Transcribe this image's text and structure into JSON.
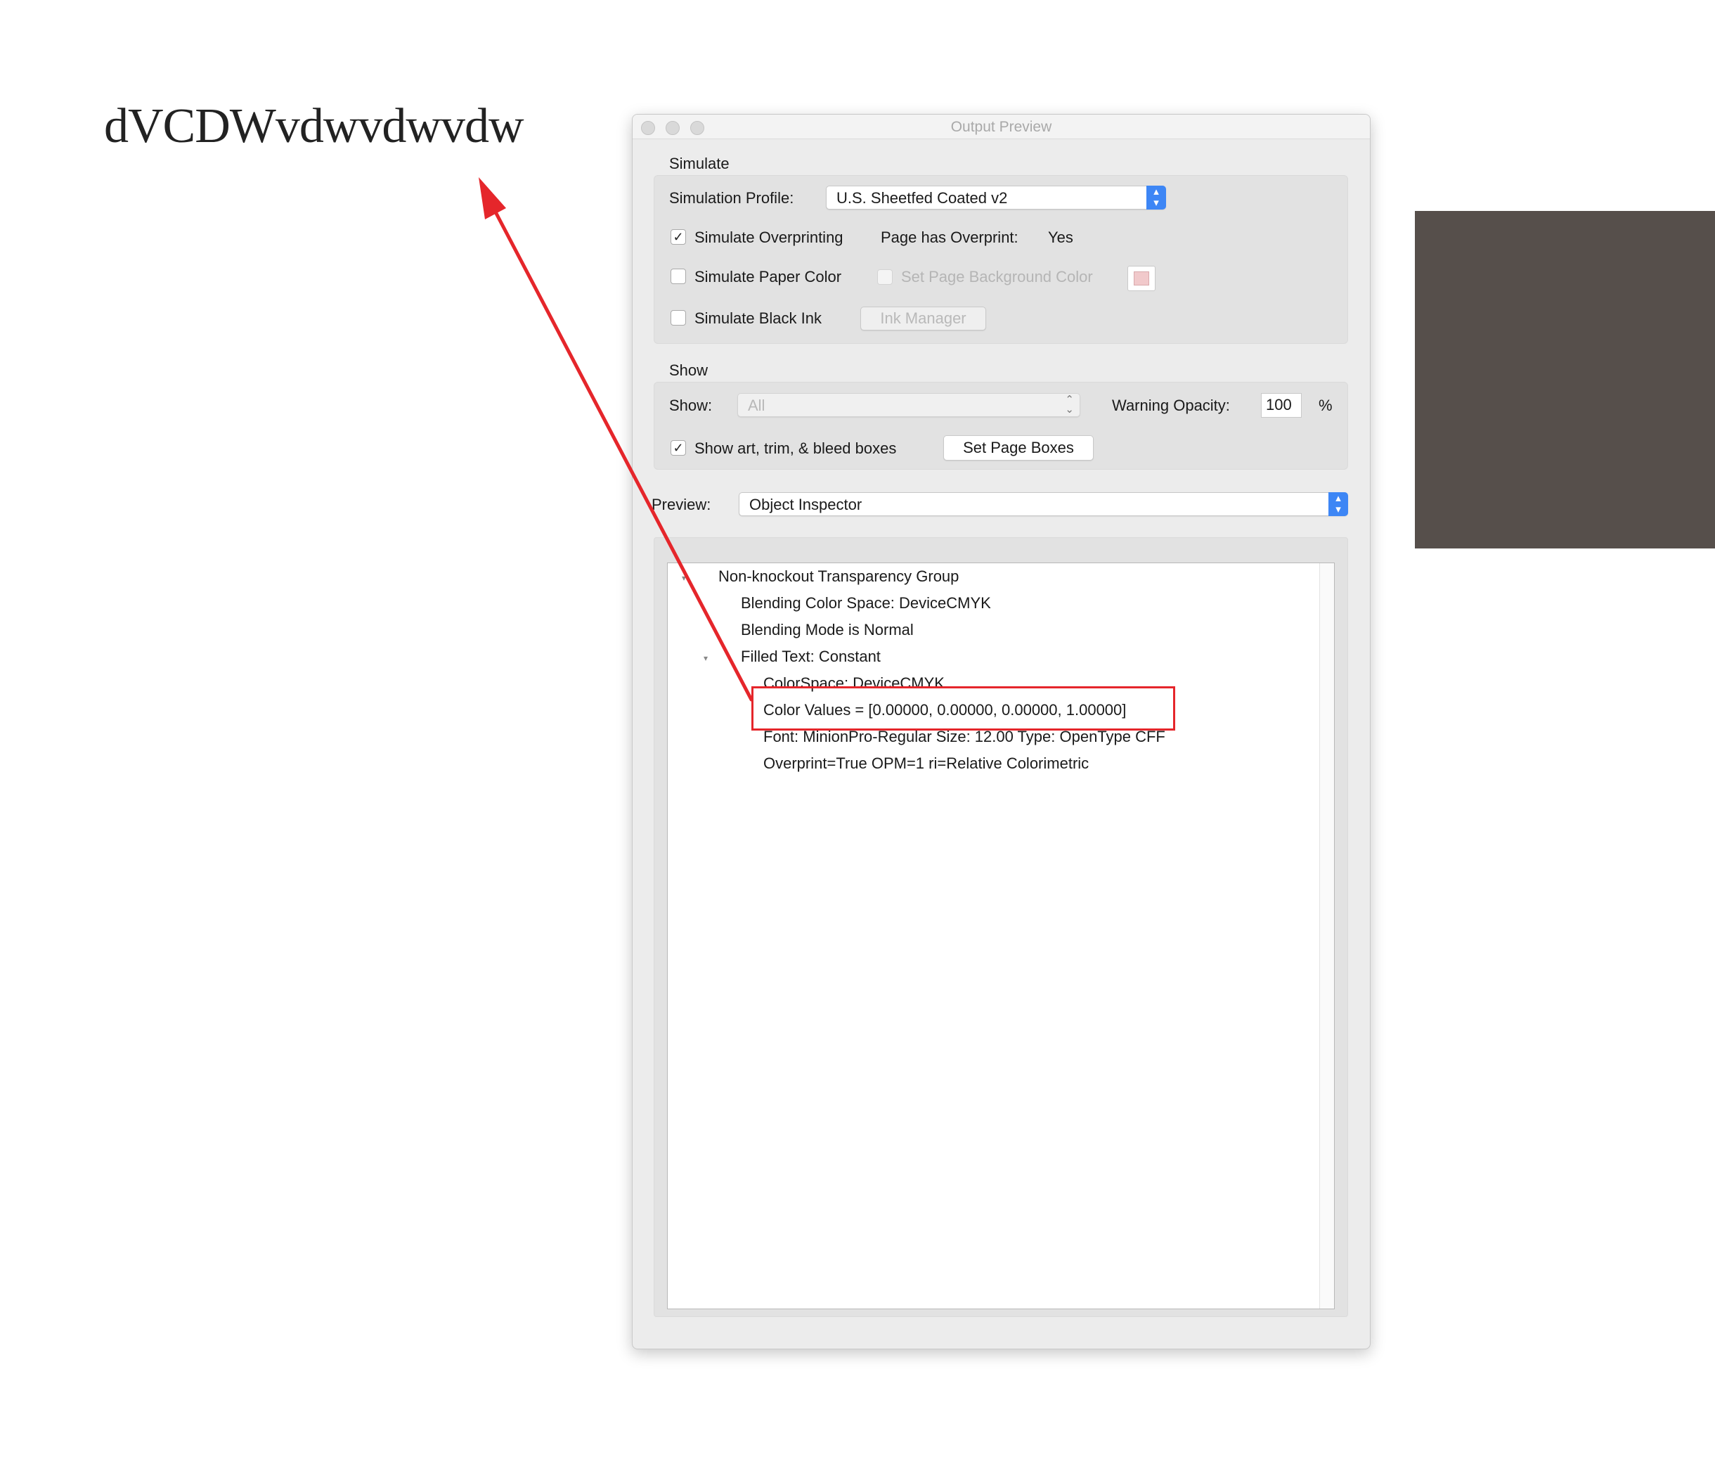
{
  "document": {
    "sample_text": "dVCDWvdwvdwvdw"
  },
  "window": {
    "title": "Output Preview"
  },
  "simulate": {
    "section_label": "Simulate",
    "profile_label": "Simulation Profile:",
    "profile_value": "U.S. Sheetfed Coated v2",
    "overprinting_label": "Simulate Overprinting",
    "overprinting_checked": true,
    "page_has_overprint_label": "Page has Overprint:",
    "page_has_overprint_value": "Yes",
    "paper_color_label": "Simulate Paper Color",
    "paper_color_checked": false,
    "page_bg_label": "Set Page Background Color",
    "black_ink_label": "Simulate Black Ink",
    "black_ink_checked": false,
    "ink_manager_label": "Ink Manager",
    "background_color": "#f1c9cb"
  },
  "show": {
    "section_label": "Show",
    "show_label": "Show:",
    "show_value": "All",
    "warning_opacity_label": "Warning Opacity:",
    "warning_opacity_value": "100",
    "percent": "%",
    "boxes_label": "Show art, trim, & bleed boxes",
    "boxes_checked": true,
    "set_page_boxes_label": "Set Page Boxes"
  },
  "preview": {
    "label": "Preview:",
    "value": "Object Inspector"
  },
  "inspector": {
    "rows": [
      "Non-knockout Transparency Group",
      "Blending Color Space: DeviceCMYK",
      "Blending Mode is Normal",
      "Filled Text: Constant",
      "ColorSpace: DeviceCMYK",
      "Color Values = [0.00000, 0.00000, 0.00000, 1.00000]",
      "Font: MinionPro-Regular Size: 12.00 Type: OpenType CFF",
      "Overprint=True OPM=1 ri=Relative Colorimetric"
    ]
  },
  "colors": {
    "annotation": "#e5262b",
    "swatch": "#564f4b",
    "accent": "#3d86f5"
  }
}
